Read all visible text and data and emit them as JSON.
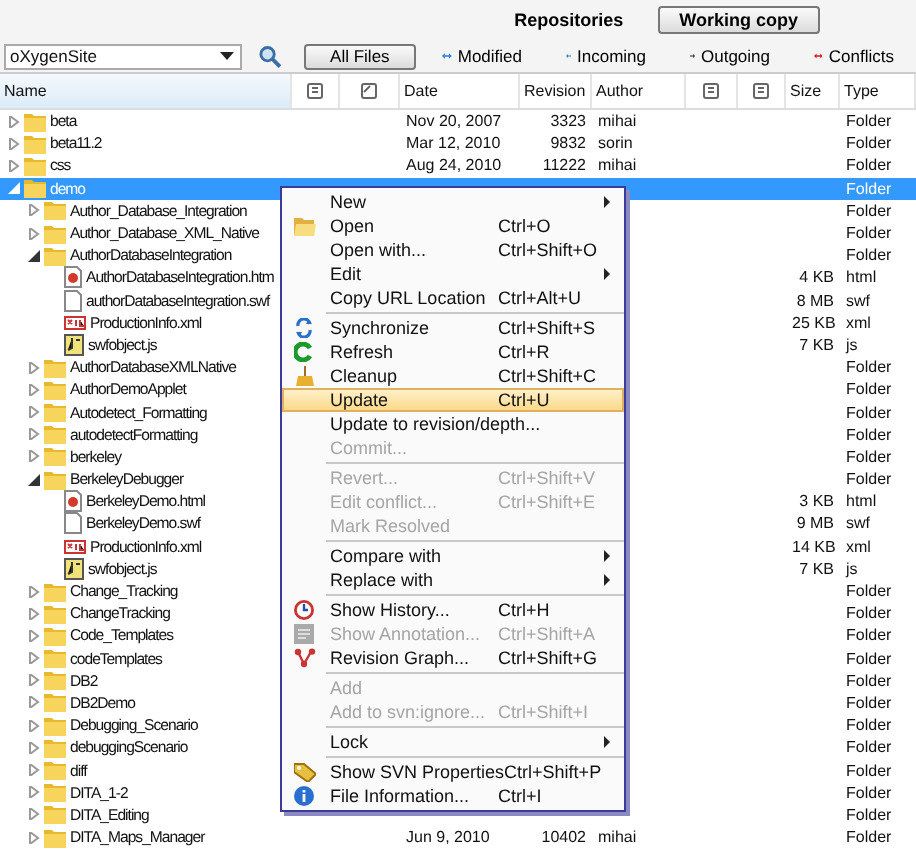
{
  "tabs": [
    {
      "label": "Repositories",
      "selected": false
    },
    {
      "label": "Working copy",
      "selected": true
    }
  ],
  "toolbar": {
    "repository": "oXygenSite",
    "filters": [
      {
        "label": "All Files",
        "selected": true
      },
      {
        "label": "Modified",
        "selected": false
      },
      {
        "label": "Incoming",
        "selected": false
      },
      {
        "label": "Outgoing",
        "selected": false
      },
      {
        "label": "Conflicts",
        "selected": false
      }
    ]
  },
  "columns": [
    {
      "kind": "text",
      "label": "Name"
    },
    {
      "kind": "icon"
    },
    {
      "kind": "icon"
    },
    {
      "kind": "text",
      "label": "Date"
    },
    {
      "kind": "text",
      "label": "Revision"
    },
    {
      "kind": "text",
      "label": "Author"
    },
    {
      "kind": "icon"
    },
    {
      "kind": "icon"
    },
    {
      "kind": "text",
      "label": "Size"
    },
    {
      "kind": "text",
      "label": "Type"
    }
  ],
  "tree": [
    {
      "name": "beta",
      "kind": "folder",
      "expanded": false,
      "selected": false,
      "date": "Nov 20, 2007",
      "revision": "3323",
      "author": "mihai",
      "type": "Folder"
    },
    {
      "name": "beta11.2",
      "kind": "folder",
      "expanded": false,
      "selected": false,
      "date": "Mar 12, 2010",
      "revision": "9832",
      "author": "sorin",
      "type": "Folder"
    },
    {
      "name": "css",
      "kind": "folder",
      "expanded": false,
      "selected": false,
      "date": "Aug 24, 2010",
      "revision": "11222",
      "author": "mihai",
      "type": "Folder"
    },
    {
      "name": "demo",
      "kind": "folder",
      "expanded": true,
      "selected": true,
      "type": "Folder",
      "children": [
        {
          "name": "Author_Database_Integration",
          "kind": "folder",
          "expanded": false,
          "selected": false,
          "type": "Folder"
        },
        {
          "name": "Author_Database_XML_Native",
          "kind": "folder",
          "expanded": false,
          "selected": false,
          "type": "Folder"
        },
        {
          "name": "AuthorDatabaseIntegration",
          "kind": "folder",
          "expanded": true,
          "selected": false,
          "type": "Folder",
          "children": [
            {
              "name": "AuthorDatabaseIntegration.htm",
              "kind": "html",
              "selected": false,
              "size": "4 KB",
              "type": "html"
            },
            {
              "name": "authorDatabaseIntegration.swf",
              "kind": "swf",
              "selected": false,
              "size": "8 MB",
              "type": "swf"
            },
            {
              "name": "ProductionInfo.xml",
              "kind": "xml",
              "selected": false,
              "size": "25 KB",
              "type": "xml"
            },
            {
              "name": "swfobject.js",
              "kind": "js",
              "selected": false,
              "size": "7 KB",
              "type": "js"
            }
          ]
        },
        {
          "name": "AuthorDatabaseXMLNative",
          "kind": "folder",
          "expanded": false,
          "selected": false,
          "type": "Folder"
        },
        {
          "name": "AuthorDemoApplet",
          "kind": "folder",
          "expanded": false,
          "selected": false,
          "type": "Folder"
        },
        {
          "name": "Autodetect_Formatting",
          "kind": "folder",
          "expanded": false,
          "selected": false,
          "type": "Folder"
        },
        {
          "name": "autodetectFormatting",
          "kind": "folder",
          "expanded": false,
          "selected": false,
          "type": "Folder"
        },
        {
          "name": "berkeley",
          "kind": "folder",
          "expanded": false,
          "selected": false,
          "type": "Folder"
        },
        {
          "name": "BerkeleyDebugger",
          "kind": "folder",
          "expanded": true,
          "selected": false,
          "type": "Folder",
          "children": [
            {
              "name": "BerkeleyDemo.html",
              "kind": "html",
              "selected": false,
              "size": "3 KB",
              "type": "html"
            },
            {
              "name": "BerkeleyDemo.swf",
              "kind": "swf",
              "selected": false,
              "size": "9 MB",
              "type": "swf"
            },
            {
              "name": "ProductionInfo.xml",
              "kind": "xml",
              "selected": false,
              "size": "14 KB",
              "type": "xml"
            },
            {
              "name": "swfobject.js",
              "kind": "js",
              "selected": false,
              "size": "7 KB",
              "type": "js"
            }
          ]
        },
        {
          "name": "Change_Tracking",
          "kind": "folder",
          "expanded": false,
          "selected": false,
          "type": "Folder"
        },
        {
          "name": "ChangeTracking",
          "kind": "folder",
          "expanded": false,
          "selected": false,
          "type": "Folder"
        },
        {
          "name": "Code_Templates",
          "kind": "folder",
          "expanded": false,
          "selected": false,
          "type": "Folder"
        },
        {
          "name": "codeTemplates",
          "kind": "folder",
          "expanded": false,
          "selected": false,
          "type": "Folder"
        },
        {
          "name": "DB2",
          "kind": "folder",
          "expanded": false,
          "selected": false,
          "type": "Folder"
        },
        {
          "name": "DB2Demo",
          "kind": "folder",
          "expanded": false,
          "selected": false,
          "type": "Folder"
        },
        {
          "name": "Debugging_Scenario",
          "kind": "folder",
          "expanded": false,
          "selected": false,
          "type": "Folder"
        },
        {
          "name": "debuggingScenario",
          "kind": "folder",
          "expanded": false,
          "selected": false,
          "type": "Folder"
        },
        {
          "name": "diff",
          "kind": "folder",
          "expanded": false,
          "selected": false,
          "type": "Folder"
        },
        {
          "name": "DITA_1-2",
          "kind": "folder",
          "expanded": false,
          "selected": false,
          "type": "Folder"
        },
        {
          "name": "DITA_Editing",
          "kind": "folder",
          "expanded": false,
          "selected": false,
          "type": "Folder"
        },
        {
          "name": "DITA_Maps_Manager",
          "kind": "folder",
          "expanded": false,
          "selected": false,
          "date": "Jun 9, 2010",
          "revision": "10402",
          "author": "mihai",
          "type": "Folder"
        }
      ]
    }
  ],
  "context_menu": {
    "groups": [
      [
        {
          "label": "New",
          "submenu": true,
          "disabled": false,
          "selected": false
        },
        {
          "label": "Open",
          "shortcut": "Ctrl+O",
          "disabled": false,
          "selected": false
        },
        {
          "label": "Open with...",
          "shortcut": "Ctrl+Shift+O",
          "disabled": false,
          "selected": false
        },
        {
          "label": "Edit",
          "submenu": true,
          "disabled": false,
          "selected": false
        },
        {
          "label": "Copy URL Location",
          "shortcut": "Ctrl+Alt+U",
          "disabled": false,
          "selected": false
        }
      ],
      [
        {
          "label": "Synchronize",
          "shortcut": "Ctrl+Shift+S",
          "disabled": false,
          "selected": false
        },
        {
          "label": "Refresh",
          "shortcut": "Ctrl+R",
          "disabled": false,
          "selected": false
        },
        {
          "label": "Cleanup",
          "shortcut": "Ctrl+Shift+C",
          "disabled": false,
          "selected": false
        },
        {
          "label": "Update",
          "shortcut": "Ctrl+U",
          "disabled": false,
          "selected": true
        },
        {
          "label": "Update to revision/depth...",
          "disabled": false,
          "selected": false
        },
        {
          "label": "Commit...",
          "disabled": true,
          "selected": false
        }
      ],
      [
        {
          "label": "Revert...",
          "shortcut": "Ctrl+Shift+V",
          "disabled": true,
          "selected": false
        },
        {
          "label": "Edit conflict...",
          "shortcut": "Ctrl+Shift+E",
          "disabled": true,
          "selected": false
        },
        {
          "label": "Mark Resolved",
          "disabled": true,
          "selected": false
        }
      ],
      [
        {
          "label": "Compare with",
          "submenu": true,
          "disabled": false,
          "selected": false
        },
        {
          "label": "Replace with",
          "submenu": true,
          "disabled": false,
          "selected": false
        }
      ],
      [
        {
          "label": "Show History...",
          "shortcut": "Ctrl+H",
          "disabled": false,
          "selected": false
        },
        {
          "label": "Show Annotation...",
          "shortcut": "Ctrl+Shift+A",
          "disabled": true,
          "selected": false
        },
        {
          "label": "Revision Graph...",
          "shortcut": "Ctrl+Shift+G",
          "disabled": false,
          "selected": false
        }
      ],
      [
        {
          "label": "Add",
          "disabled": true,
          "selected": false
        },
        {
          "label": "Add to svn:ignore...",
          "shortcut": "Ctrl+Shift+I",
          "disabled": true,
          "selected": false
        }
      ],
      [
        {
          "label": "Lock",
          "submenu": true,
          "disabled": false,
          "selected": false
        }
      ],
      [
        {
          "label": "Show SVN Properties",
          "shortcut": "Ctrl+Shift+P",
          "disabled": false,
          "selected": false
        },
        {
          "label": "File Information...",
          "shortcut": "Ctrl+I",
          "disabled": false,
          "selected": false
        }
      ]
    ]
  }
}
